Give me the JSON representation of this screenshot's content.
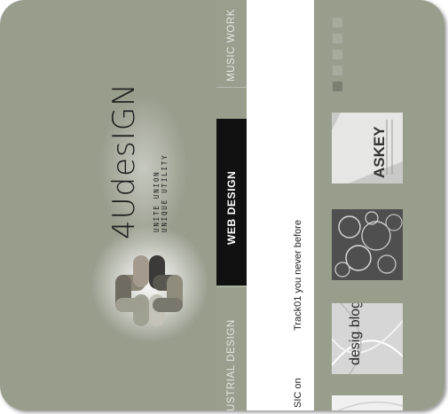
{
  "brand": {
    "name": "4UdesIGN",
    "tagline_1": "UNITE UNION",
    "tagline_2": "UNIQUE UTILITY"
  },
  "nav": {
    "items": [
      {
        "label": "MUSIC WORK",
        "active": false
      },
      {
        "label": "WEB DESIGN",
        "active": true
      },
      {
        "label": "USTRIAL DESIGN",
        "active": false
      }
    ]
  },
  "news": {
    "line_1": "Track01 you never before",
    "line_2": "SIC on"
  },
  "gallery": {
    "pager_dots": 5,
    "active_dot": 4,
    "thumbs": [
      {
        "icon": "askey-photo",
        "caption": "ASKEY"
      },
      {
        "icon": "wire-tangle-photo"
      },
      {
        "icon": "design-blog-photo",
        "caption": "desig blog"
      },
      {
        "icon": "white-photo"
      }
    ]
  },
  "colors": {
    "panel": "#999d8c",
    "nav_active": "#111111",
    "nav_text": "#e4e6de"
  }
}
